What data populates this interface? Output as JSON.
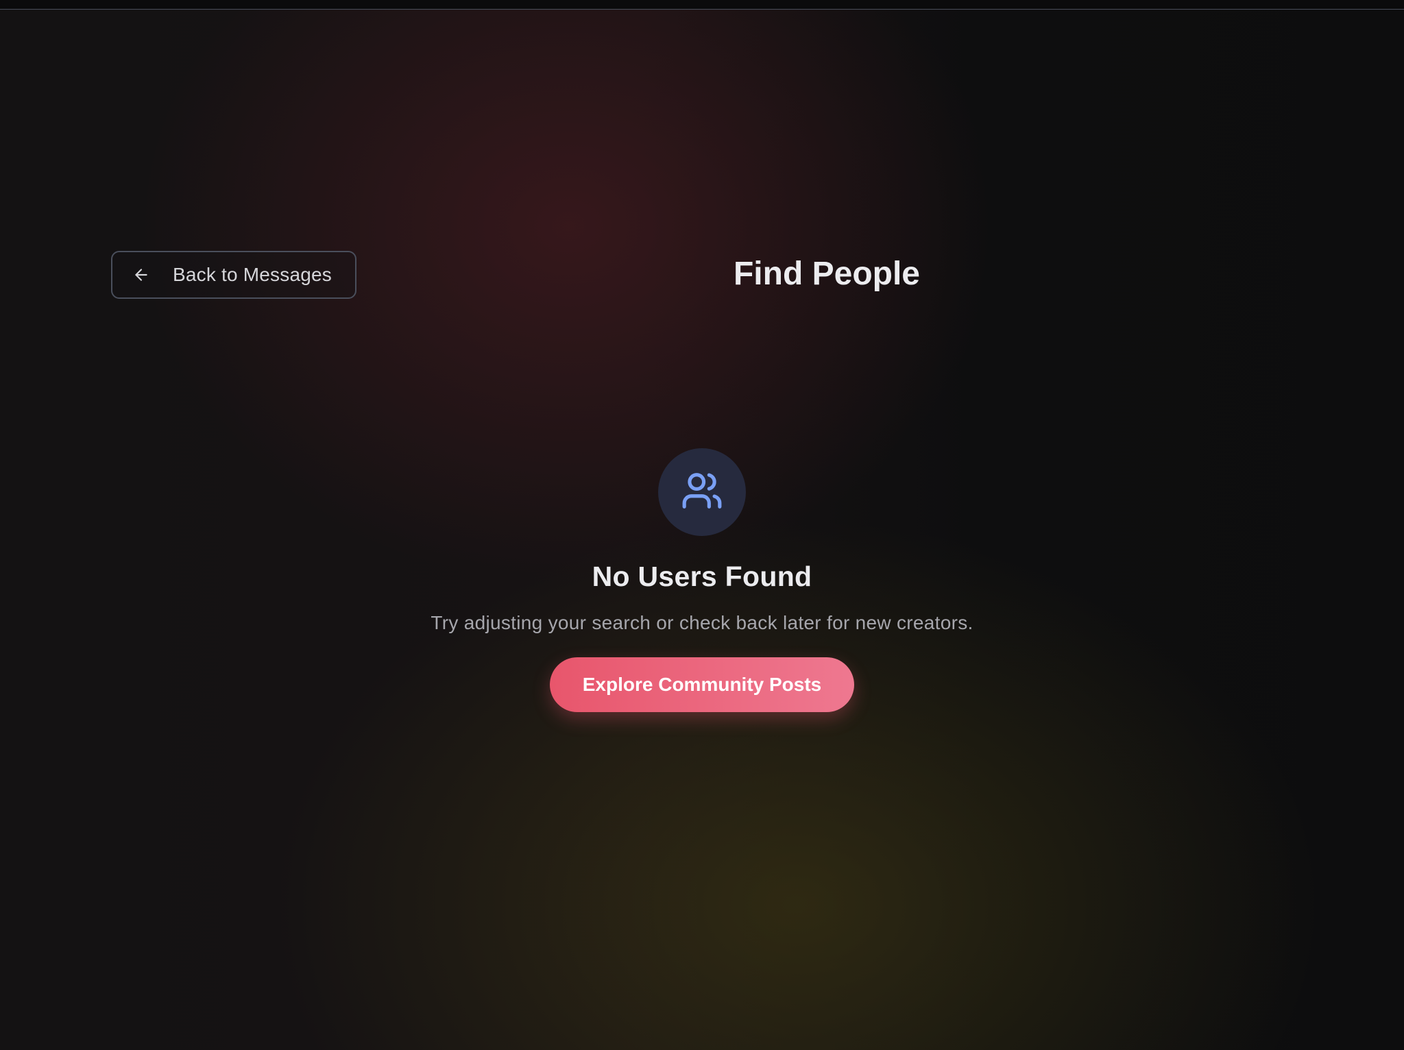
{
  "header": {
    "back_button_label": "Back to Messages",
    "back_icon": "arrow-left-icon",
    "title": "Find People"
  },
  "empty_state": {
    "icon": "users-icon",
    "heading": "No Users Found",
    "message": "Try adjusting your search or check back later for new creators.",
    "cta_label": "Explore Community Posts"
  },
  "colors": {
    "accent_gradient_start": "#e8566c",
    "accent_gradient_end": "#ee7890",
    "icon_blue": "#7aa0f5",
    "icon_circle": "#262a3e"
  }
}
